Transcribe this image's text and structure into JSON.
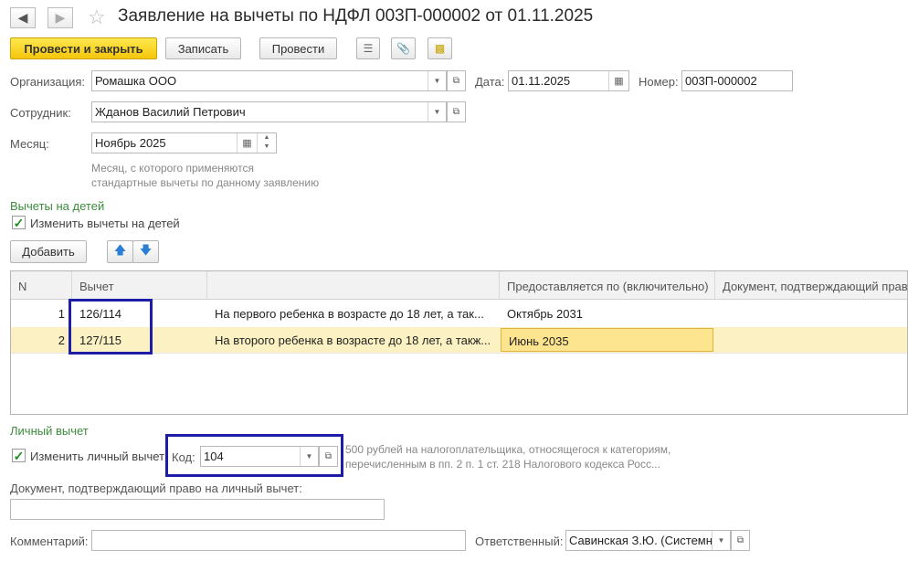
{
  "header": {
    "back_icon": "arrow-left",
    "forward_icon": "arrow-right",
    "star_icon": "star-outline",
    "title": "Заявление на вычеты по НДФЛ 003П-000002 от 01.11.2025"
  },
  "toolbar": {
    "post_and_close": "Провести и закрыть",
    "save": "Записать",
    "post": "Провести",
    "icons": [
      "list-icon",
      "paperclip-icon",
      "report-icon"
    ]
  },
  "form": {
    "org_label": "Организация:",
    "org_value": "Ромашка ООО",
    "date_label": "Дата:",
    "date_value": "01.11.2025",
    "number_label": "Номер:",
    "number_value": "003П-000002",
    "employee_label": "Сотрудник:",
    "employee_value": "Жданов Василий Петрович",
    "month_label": "Месяц:",
    "month_value": "Ноябрь 2025",
    "month_hint_line1": "Месяц, с которого применяются",
    "month_hint_line2": "стандартные вычеты по данному заявлению"
  },
  "children": {
    "section_title": "Вычеты на детей",
    "change_checkbox_label": "Изменить вычеты на детей",
    "change_checked": true,
    "add_button": "Добавить",
    "table": {
      "columns": [
        "N",
        "Вычет",
        "",
        "Предоставляется по (включительно)",
        "Документ, подтверждающий право"
      ],
      "rows": [
        {
          "n": "1",
          "code": "126/114",
          "description": "На первого ребенка в возрасте до 18 лет, а так...",
          "until": "Октябрь 2031",
          "document": ""
        },
        {
          "n": "2",
          "code": "127/115",
          "description": "На второго ребенка в возрасте до 18 лет, а такж...",
          "until": "Июнь 2035",
          "document": ""
        }
      ]
    }
  },
  "personal": {
    "section_title": "Личный вычет",
    "change_checkbox_label": "Изменить личный вычет",
    "change_checked": true,
    "code_label": "Код:",
    "code_value": "104",
    "code_hint_line1": "500 рублей на налогоплательщика, относящегося к категориям,",
    "code_hint_line2": "перечисленным в пп. 2 п. 1 ст. 218 Налогового кодекса Росс...",
    "document_label": "Документ, подтверждающий право на личный вычет:",
    "document_value": ""
  },
  "footer": {
    "comment_label": "Комментарий:",
    "comment_value": "",
    "responsible_label": "Ответственный:",
    "responsible_value": "Савинская З.Ю. (Системн"
  },
  "colors": {
    "primary_button": "#f5c60c",
    "section_title": "#3c8c3c",
    "selected_row": "#fcf1c2",
    "highlight_box": "#1d1da8"
  }
}
